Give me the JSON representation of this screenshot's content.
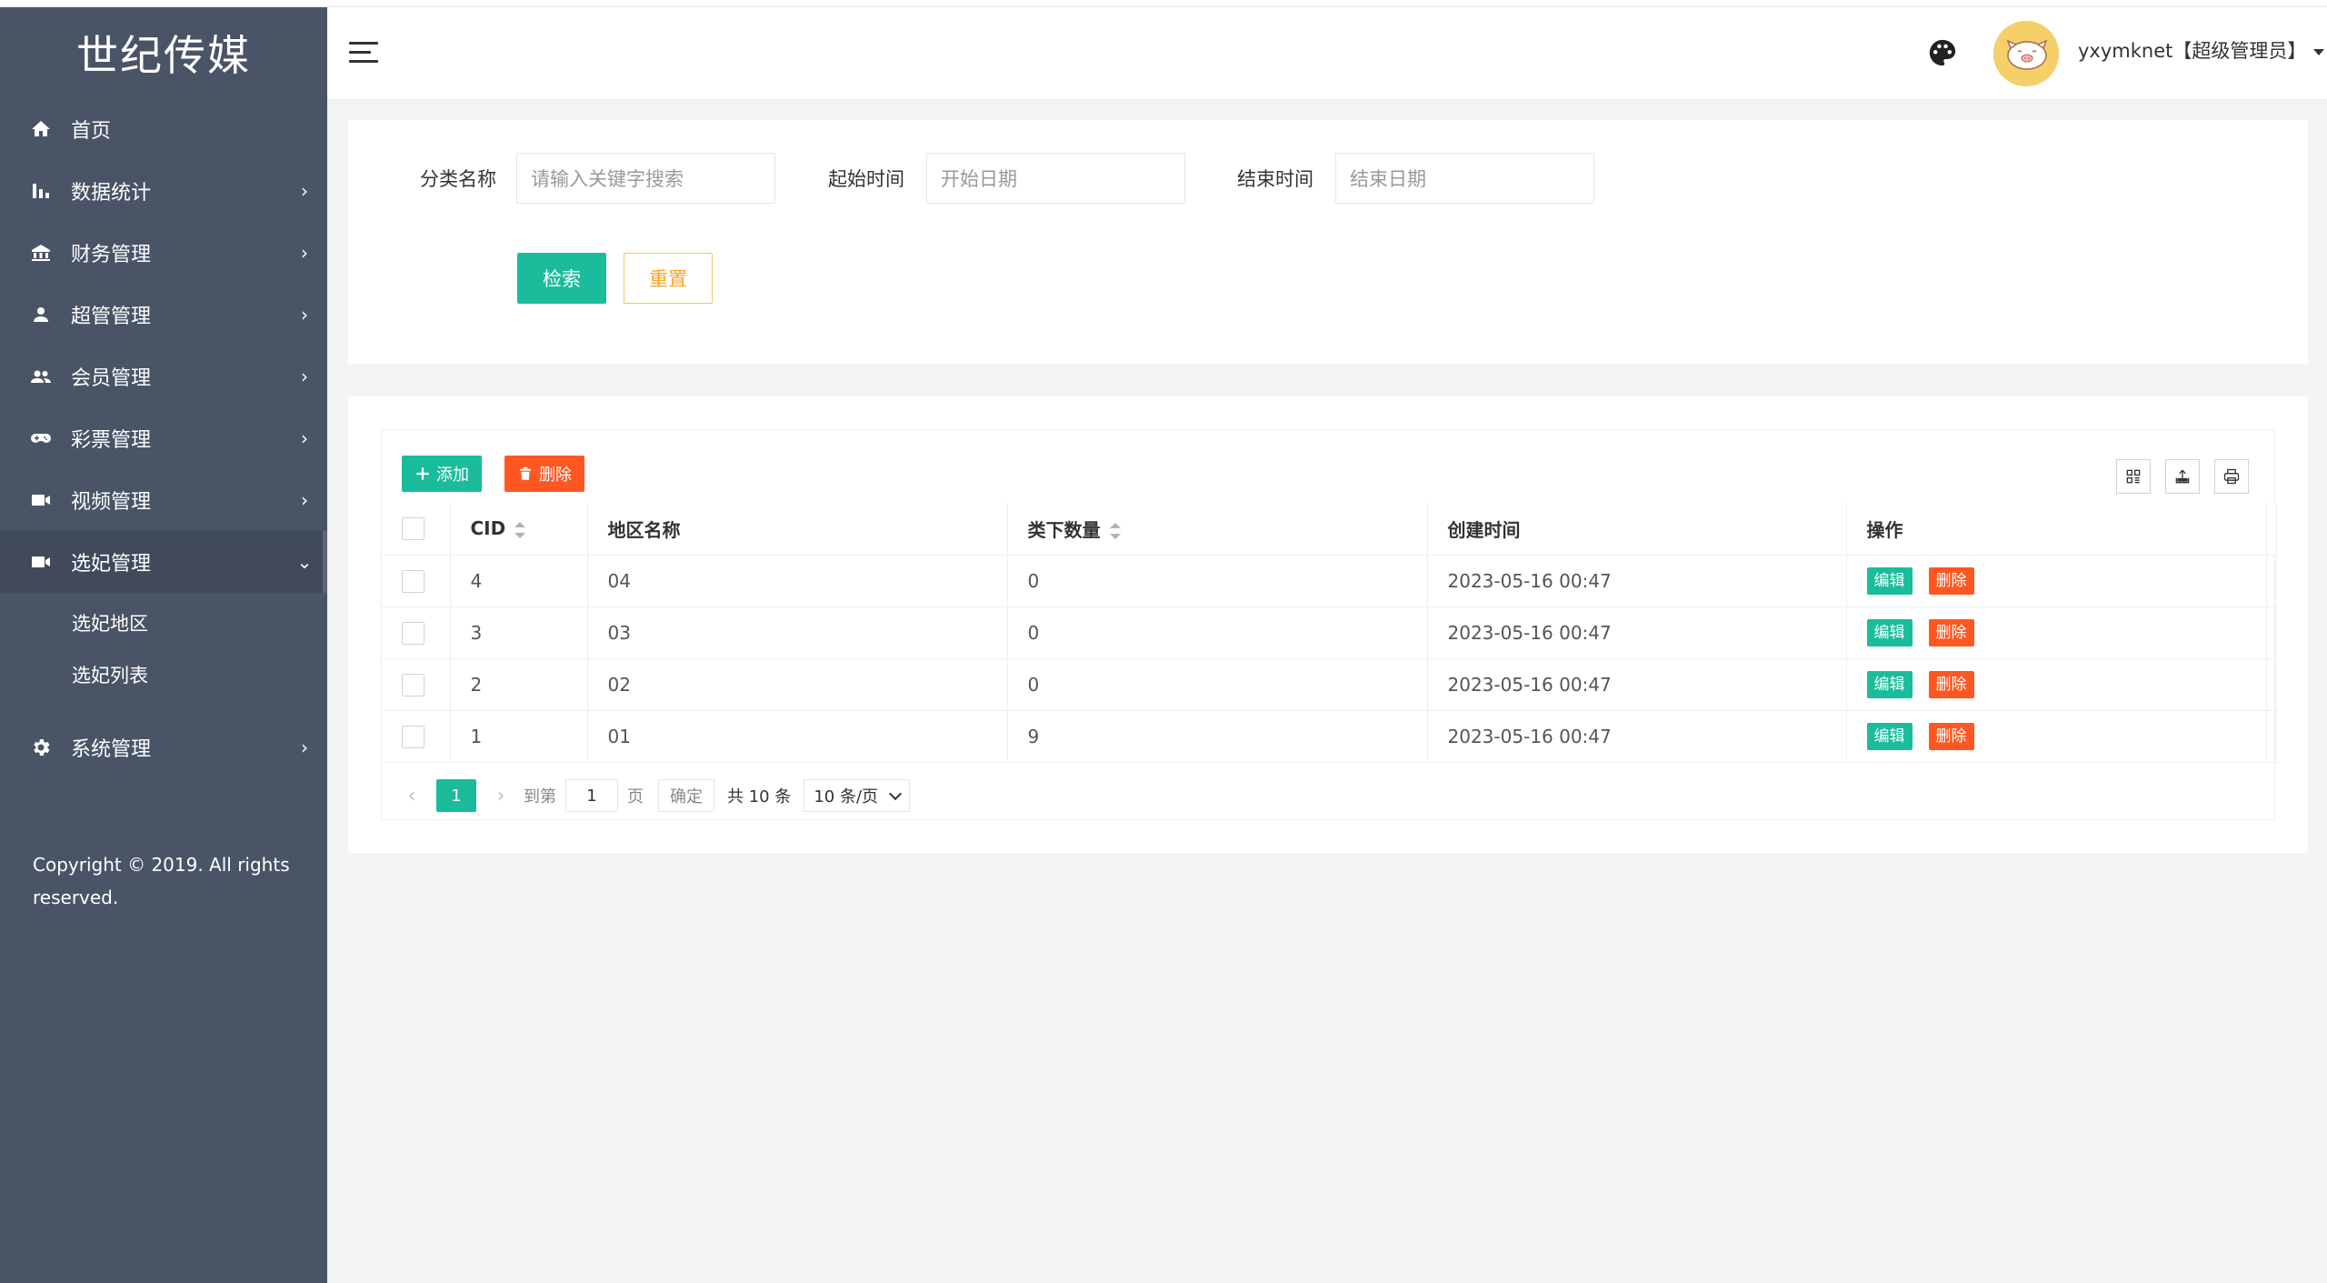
{
  "brand": "世纪传媒",
  "sidebar": {
    "items": [
      {
        "label": "首页",
        "icon": "home-icon"
      },
      {
        "label": "数据统计",
        "icon": "bar-chart-icon",
        "arrow": "›"
      },
      {
        "label": "财务管理",
        "icon": "bank-icon",
        "arrow": "›"
      },
      {
        "label": "超管管理",
        "icon": "user-icon",
        "arrow": "›"
      },
      {
        "label": "会员管理",
        "icon": "users-icon",
        "arrow": "›"
      },
      {
        "label": "彩票管理",
        "icon": "gamepad-icon",
        "arrow": "›"
      },
      {
        "label": "视频管理",
        "icon": "video-icon",
        "arrow": "›"
      },
      {
        "label": "选妃管理",
        "icon": "video-icon",
        "arrow": "⌄",
        "active": true
      },
      {
        "label": "系统管理",
        "icon": "gear-icon",
        "arrow": "›"
      }
    ],
    "subitems": [
      "选妃地区",
      "选妃列表"
    ],
    "copyright": "Copyright © 2019. All rights reserved."
  },
  "header": {
    "username": "yxymknet【超级管理员】"
  },
  "search": {
    "category_label": "分类名称",
    "category_placeholder": "请输入关键字搜索",
    "start_label": "起始时间",
    "start_placeholder": "开始日期",
    "end_label": "结束时间",
    "end_placeholder": "结束日期",
    "search_btn": "检索",
    "reset_btn": "重置"
  },
  "toolbar": {
    "add_label": "添加",
    "delete_label": "删除"
  },
  "table": {
    "columns": [
      "CID",
      "地区名称",
      "类下数量",
      "创建时间",
      "操作"
    ],
    "rows": [
      {
        "cid": "4",
        "name": "04",
        "count": "0",
        "created": "2023-05-16 00:47"
      },
      {
        "cid": "3",
        "name": "03",
        "count": "0",
        "created": "2023-05-16 00:47"
      },
      {
        "cid": "2",
        "name": "02",
        "count": "0",
        "created": "2023-05-16 00:47"
      },
      {
        "cid": "1",
        "name": "01",
        "count": "9",
        "created": "2023-05-16 00:47"
      }
    ],
    "edit_label": "编辑",
    "delete_label": "删除"
  },
  "pager": {
    "prev": "‹",
    "current": "1",
    "next": "›",
    "goto_label": "到第",
    "goto_value": "1",
    "page_unit": "页",
    "confirm": "确定",
    "total": "共 10 条",
    "page_size": "10 条/页"
  },
  "colors": {
    "sidebar_bg": "#4a5467",
    "primary": "#1bbc9b",
    "danger": "#ff5722",
    "warn": "#f5a623"
  }
}
